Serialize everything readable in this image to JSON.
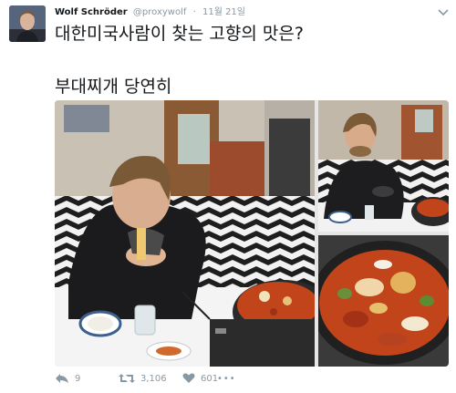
{
  "tweet": {
    "author_name": "Wolf Schröder",
    "author_handle": "@proxywolf",
    "separator": "·",
    "timestamp": "11월 21일",
    "text_line1": "대한미국사람이 찾는 고향의 맛은?",
    "text_line2": "부대찌개 당연히"
  },
  "actions": {
    "reply_count": "9",
    "retweet_count": "3,106",
    "like_count": "601",
    "more_glyph": "•••"
  },
  "colors": {
    "text": "#14171a",
    "muted": "#8899a6",
    "background": "#ffffff",
    "zigzag_dark": "#1e1e1e",
    "stew_red": "#c1441a"
  }
}
